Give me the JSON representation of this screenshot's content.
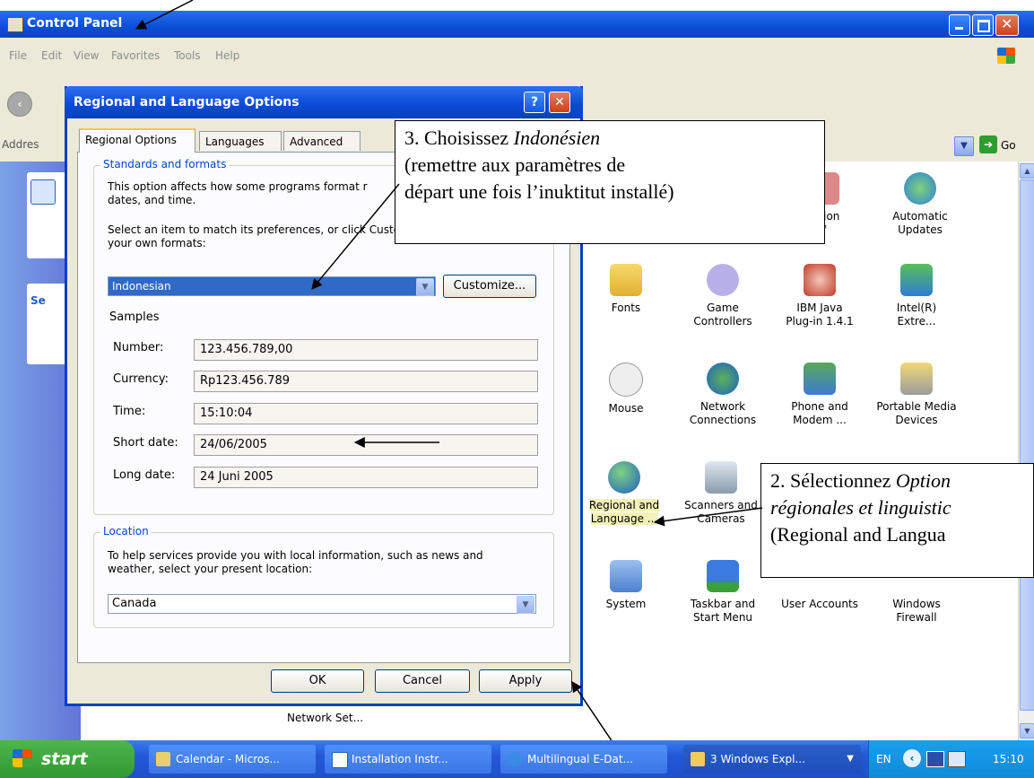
{
  "cp": {
    "title": "Control Panel",
    "menu": [
      "File",
      "Edit",
      "View",
      "Favorites",
      "Tools",
      "Help"
    ],
    "address_label": "Addres",
    "go_label": "Go",
    "left_pane_heading": "Se",
    "bottom_text": "Network Set..."
  },
  "icons": [
    {
      "label": "ersion\n™",
      "icon": "version-icon"
    },
    {
      "label": "Automatic\nUpdates",
      "icon": "automatic-updates-icon"
    },
    {
      "label": "Fonts",
      "icon": "fonts-folder-icon"
    },
    {
      "label": "Game\nControllers",
      "icon": "game-controller-icon"
    },
    {
      "label": "IBM Java\nPlug-in 1.4.1",
      "icon": "java-icon"
    },
    {
      "label": "Intel(R)\nExtre...",
      "icon": "intel-graphics-icon"
    },
    {
      "label": "Mouse",
      "icon": "mouse-icon"
    },
    {
      "label": "Network\nConnections",
      "icon": "network-icon"
    },
    {
      "label": "Phone and\nModem ...",
      "icon": "phone-modem-icon"
    },
    {
      "label": "Portable Media\nDevices",
      "icon": "portable-media-icon"
    },
    {
      "label": "Regional and\nLanguage ...",
      "icon": "globe-icon"
    },
    {
      "label": "Scanners and\nCameras",
      "icon": "scanner-icon"
    },
    {
      "label": "System",
      "icon": "system-icon"
    },
    {
      "label": "Taskbar and\nStart Menu",
      "icon": "taskbar-icon"
    },
    {
      "label": "User Accounts",
      "icon": "user-accounts-icon"
    },
    {
      "label": "Windows\nFirewall",
      "icon": "firewall-icon"
    }
  ],
  "dialog": {
    "title": "Regional and Language Options",
    "help_glyph": "?",
    "tabs": [
      "Regional Options",
      "Languages",
      "Advanced"
    ],
    "standards": {
      "group_label": "Standards and formats",
      "desc": "This option affects how some programs format r\ndates, and time.",
      "select_text": "Select an item to match its preferences, or click Customize to choose\nyour own formats:",
      "format_value": "Indonesian",
      "customize_label": "Customize...",
      "samples_label": "Samples",
      "samples": [
        {
          "label": "Number:",
          "value": "123.456.789,00"
        },
        {
          "label": "Currency:",
          "value": "Rp123.456.789"
        },
        {
          "label": "Time:",
          "value": "15:10:04"
        },
        {
          "label": "Short date:",
          "value": "24/06/2005"
        },
        {
          "label": "Long date:",
          "value": "24 Juni 2005"
        }
      ]
    },
    "location": {
      "group_label": "Location",
      "desc": "To help services provide you with local information, such as news and\nweather, select your present location:",
      "value": "Canada"
    },
    "buttons": {
      "ok": "OK",
      "cancel": "Cancel",
      "apply": "Apply"
    }
  },
  "callouts": {
    "step3_prefix": "3. Choisissez ",
    "step3_italic": "Indonésien",
    "step3_rest_1": "(remettre aux paramètres de",
    "step3_rest_2": "départ une fois l’inuktitut installé)",
    "step2_prefix": "2. Sélectionnez ",
    "step2_italic_1": "Option",
    "step2_italic_2": "régionales et linguistic",
    "step2_rest": "(Regional and Langua"
  },
  "taskbar": {
    "start": "start",
    "tasks": [
      {
        "label": "Calendar - Micros...",
        "icon": "calendar-icon"
      },
      {
        "label": "Installation Instr...",
        "icon": "word-icon"
      },
      {
        "label": "Multilingual E-Dat...",
        "icon": "ie-icon"
      },
      {
        "label": "3 Windows Expl...",
        "icon": "folder-icon"
      }
    ],
    "lang": "EN",
    "clock": "15:10"
  },
  "colors": {
    "xp_blue": "#0a4fd6",
    "selection": "#316ac5",
    "group_label": "#0046d5"
  }
}
